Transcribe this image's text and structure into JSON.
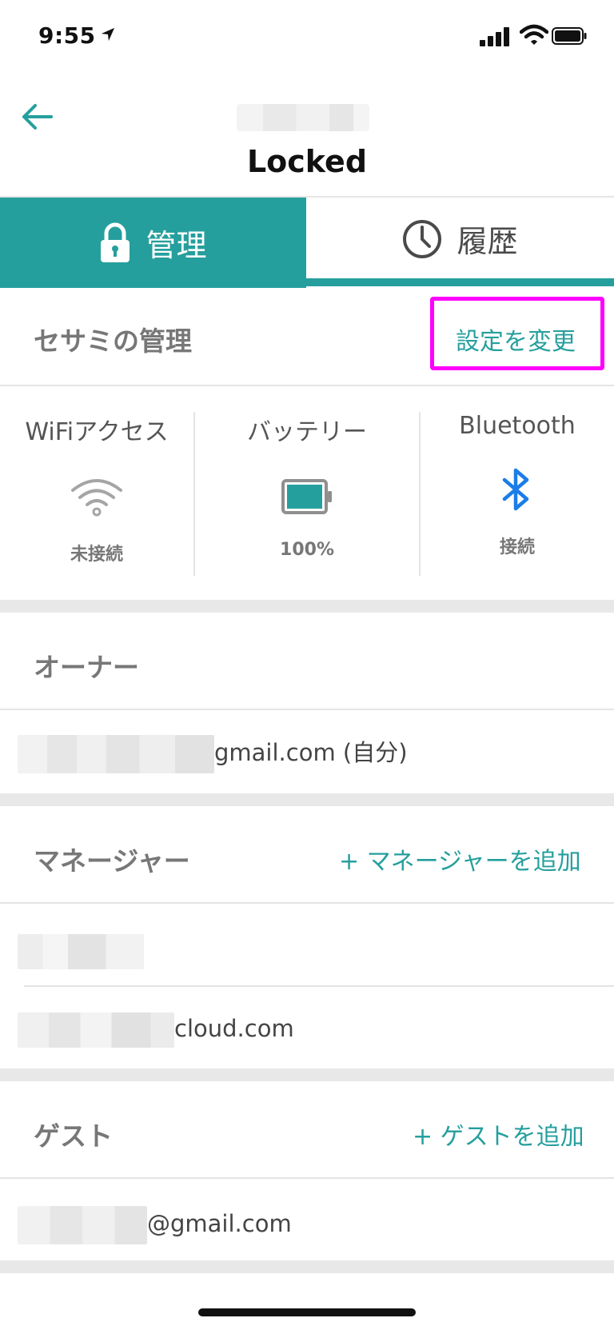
{
  "status_bar": {
    "time": "9:55"
  },
  "header": {
    "title": "Locked"
  },
  "tabs": [
    {
      "label": "管理"
    },
    {
      "label": "履歴"
    }
  ],
  "manage_section": {
    "title": "セサミの管理",
    "change_settings_label": "設定を変更"
  },
  "status": {
    "wifi": {
      "label": "WiFiアクセス",
      "value": "未接続"
    },
    "battery": {
      "label": "バッテリー",
      "value": "100%"
    },
    "bluetooth": {
      "label": "Bluetooth",
      "value": "接続"
    }
  },
  "owner": {
    "title": "オーナー",
    "email_suffix": "gmail.com (自分)"
  },
  "managers": {
    "title": "マネージャー",
    "add_label": "+ マネージャーを追加",
    "items": [
      {
        "suffix": ""
      },
      {
        "suffix": "cloud.com"
      }
    ]
  },
  "guests": {
    "title": "ゲスト",
    "add_label": "+ ゲストを追加",
    "items": [
      {
        "suffix": "@gmail.com"
      }
    ]
  },
  "colors": {
    "accent": "#259f9d",
    "bluetooth": "#1a7de8",
    "highlight": "#ff00ff"
  }
}
